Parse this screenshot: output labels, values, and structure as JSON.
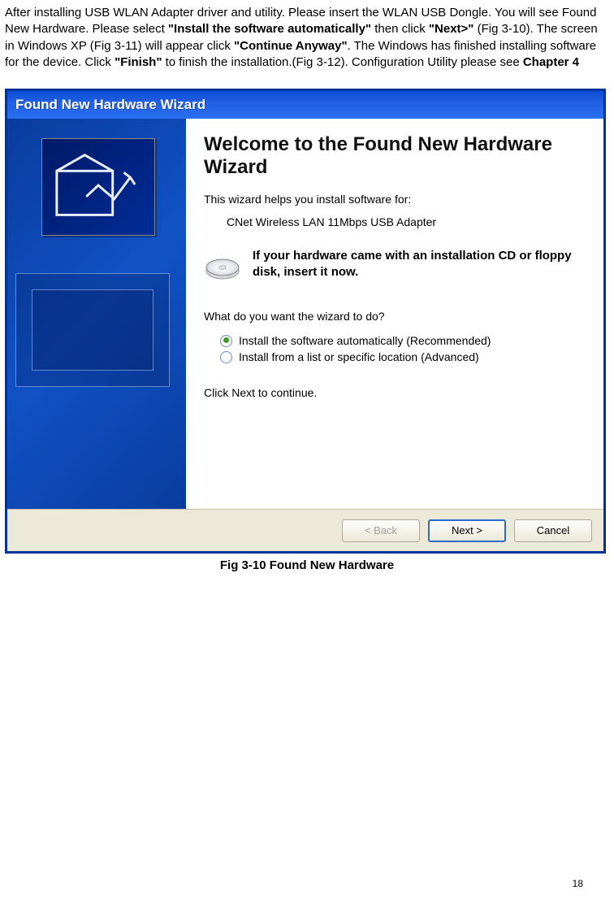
{
  "doc": {
    "p1a": "After installing USB WLAN Adapter driver and utility. Please insert the WLAN USB Dongle. You will see Found New Hardware. Please select ",
    "p1b": "\"Install the software automatically\"",
    "p1c": " then click ",
    "p1d": "\"Next>\"",
    "p1e": " (Fig 3-10). The screen in Windows XP (Fig 3-11) will appear click ",
    "p1f": "\"Continue Anyway\"",
    "p1g": ". The Windows has finished installing software for the device. Click ",
    "p1h": "\"Finish\"",
    "p1i": " to finish the installation.(Fig 3-12). Configuration Utility please see ",
    "p1j": "Chapter 4"
  },
  "wizard": {
    "title": "Found New Hardware Wizard",
    "heading": "Welcome to the Found New Hardware Wizard",
    "helps": "This wizard helps you install software for:",
    "device": "CNet Wireless LAN 11Mbps USB Adapter",
    "cd_note": "If your hardware came with an installation CD or floppy disk, insert it now.",
    "question": "What do you want the wizard to do?",
    "option_auto": "Install the software automatically (Recommended)",
    "option_list": "Install from a list or specific location (Advanced)",
    "click_next": "Click Next to continue.",
    "buttons": {
      "back": "< Back",
      "next": "Next >",
      "cancel": "Cancel"
    }
  },
  "caption": "Fig 3-10 Found New Hardware",
  "page_number": "18"
}
